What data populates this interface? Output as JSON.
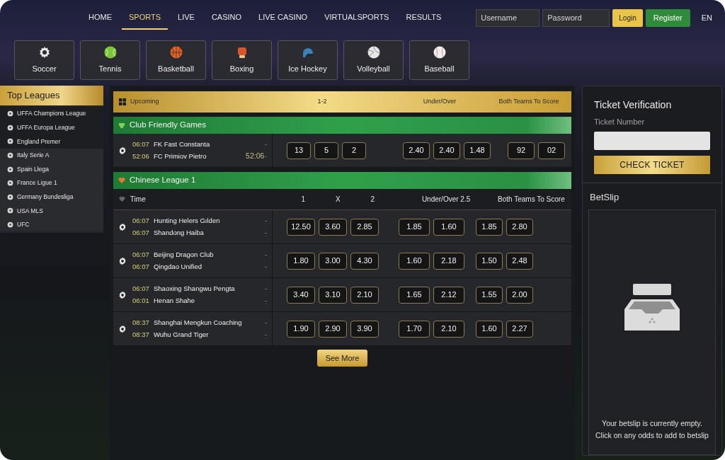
{
  "nav": {
    "items": [
      {
        "label": "HOME",
        "selected": false
      },
      {
        "label": "SPORTS",
        "selected": true
      },
      {
        "label": "LIVE",
        "selected": false
      },
      {
        "label": "CASINO",
        "selected": false
      },
      {
        "label": "LIVE CASINO",
        "selected": false
      },
      {
        "label": "VIRTUALSPORTS",
        "selected": false
      },
      {
        "label": "RESULTS",
        "selected": false
      }
    ],
    "username": {
      "placeholder": "Username"
    },
    "password": {
      "placeholder": "Password"
    },
    "login": "Login",
    "register": "Register",
    "language": "EN"
  },
  "sports": [
    {
      "label": "Soccer"
    },
    {
      "label": "Tennis"
    },
    {
      "label": "Basketball"
    },
    {
      "label": "Boxing"
    },
    {
      "label": "Ice Hockey"
    },
    {
      "label": "Volleyball"
    },
    {
      "label": "Baseball"
    }
  ],
  "sidebar": {
    "title": "Top Leagues",
    "items": [
      "UFFA Champions League",
      "UFFA Europa League",
      "England Premer",
      "Italy Serie A",
      "Spain Lłega",
      "France Ligue 1",
      "Germany Bundesliga",
      "USA MLS",
      "UFC"
    ]
  },
  "upcoming": {
    "title": "Upcoming",
    "columns": [
      "1-2",
      "Under/Over",
      "Both Teams To Score"
    ]
  },
  "groups": [
    {
      "title": "Club Friendly Games",
      "kind": "friendly",
      "matches": [
        {
          "time_1": "06:07",
          "team_1": "FK Fast Constanta",
          "score_1": "-",
          "time_2": "52:06",
          "team_2": "FC Primiov Pietro",
          "score_2": "-",
          "clock": "52:06",
          "odds_1x2": [
            "13",
            "5",
            "2"
          ],
          "odds_under_over": [
            "2.40",
            "2.40",
            "1.48"
          ],
          "odds_both_score": [
            "92",
            "02"
          ]
        }
      ]
    },
    {
      "title": "Chinese League 1",
      "kind": "league",
      "header": {
        "time": "Time",
        "columns_1x2": [
          "1",
          "X",
          "2"
        ],
        "under_over": "Under/Over 2.5",
        "both_score": "Both Teams To Score"
      },
      "matches": [
        {
          "time_1": "06:07",
          "team_1": "Hunting Helers Gılden",
          "score_1": "-",
          "time_2": "06:07",
          "team_2": "Shandong Haiba",
          "score_2": "-",
          "odds_1x2": [
            "12.50",
            "3.60",
            "2.85"
          ],
          "odds_under_over": [
            "1.85",
            "1.60"
          ],
          "odds_both_score": [
            "1.85",
            "2.80"
          ]
        },
        {
          "time_1": "06:07",
          "team_1": "Beijing Dragon Club",
          "score_1": "-",
          "time_2": "06:07",
          "team_2": "Qingdao Unified",
          "score_2": "-",
          "odds_1x2": [
            "1.80",
            "3.00",
            "4.30"
          ],
          "odds_under_over": [
            "1.60",
            "2.18"
          ],
          "odds_both_score": [
            "1.50",
            "2.48"
          ]
        },
        {
          "time_1": "06:07",
          "team_1": "Shaoxing Shangwu Pengta",
          "score_1": "-",
          "time_2": "06:01",
          "team_2": "Henan Shahe",
          "score_2": "-",
          "odds_1x2": [
            "3.40",
            "3.10",
            "2.10"
          ],
          "odds_under_over": [
            "1.65",
            "2.12"
          ],
          "odds_both_score": [
            "1.55",
            "2.00"
          ]
        },
        {
          "time_1": "08:37",
          "team_1": "Shanghai Mengkun Coaching",
          "score_1": "-",
          "time_2": "08:37",
          "team_2": "Wuhu Grand Tiger",
          "score_2": "-",
          "odds_1x2": [
            "1.90",
            "2.90",
            "3.90"
          ],
          "odds_under_over": [
            "1.70",
            "2.10"
          ],
          "odds_both_score": [
            "1.60",
            "2.27"
          ]
        }
      ]
    }
  ],
  "see_more": "See More",
  "ticket": {
    "title": "Ticket Verification",
    "label": "Ticket Number",
    "button": "CHECK TICKET"
  },
  "betslip": {
    "title": "BetSlip",
    "empty_lines": [
      "Your betslip is currently empty.",
      "Click on any odds to add to betslip"
    ]
  }
}
